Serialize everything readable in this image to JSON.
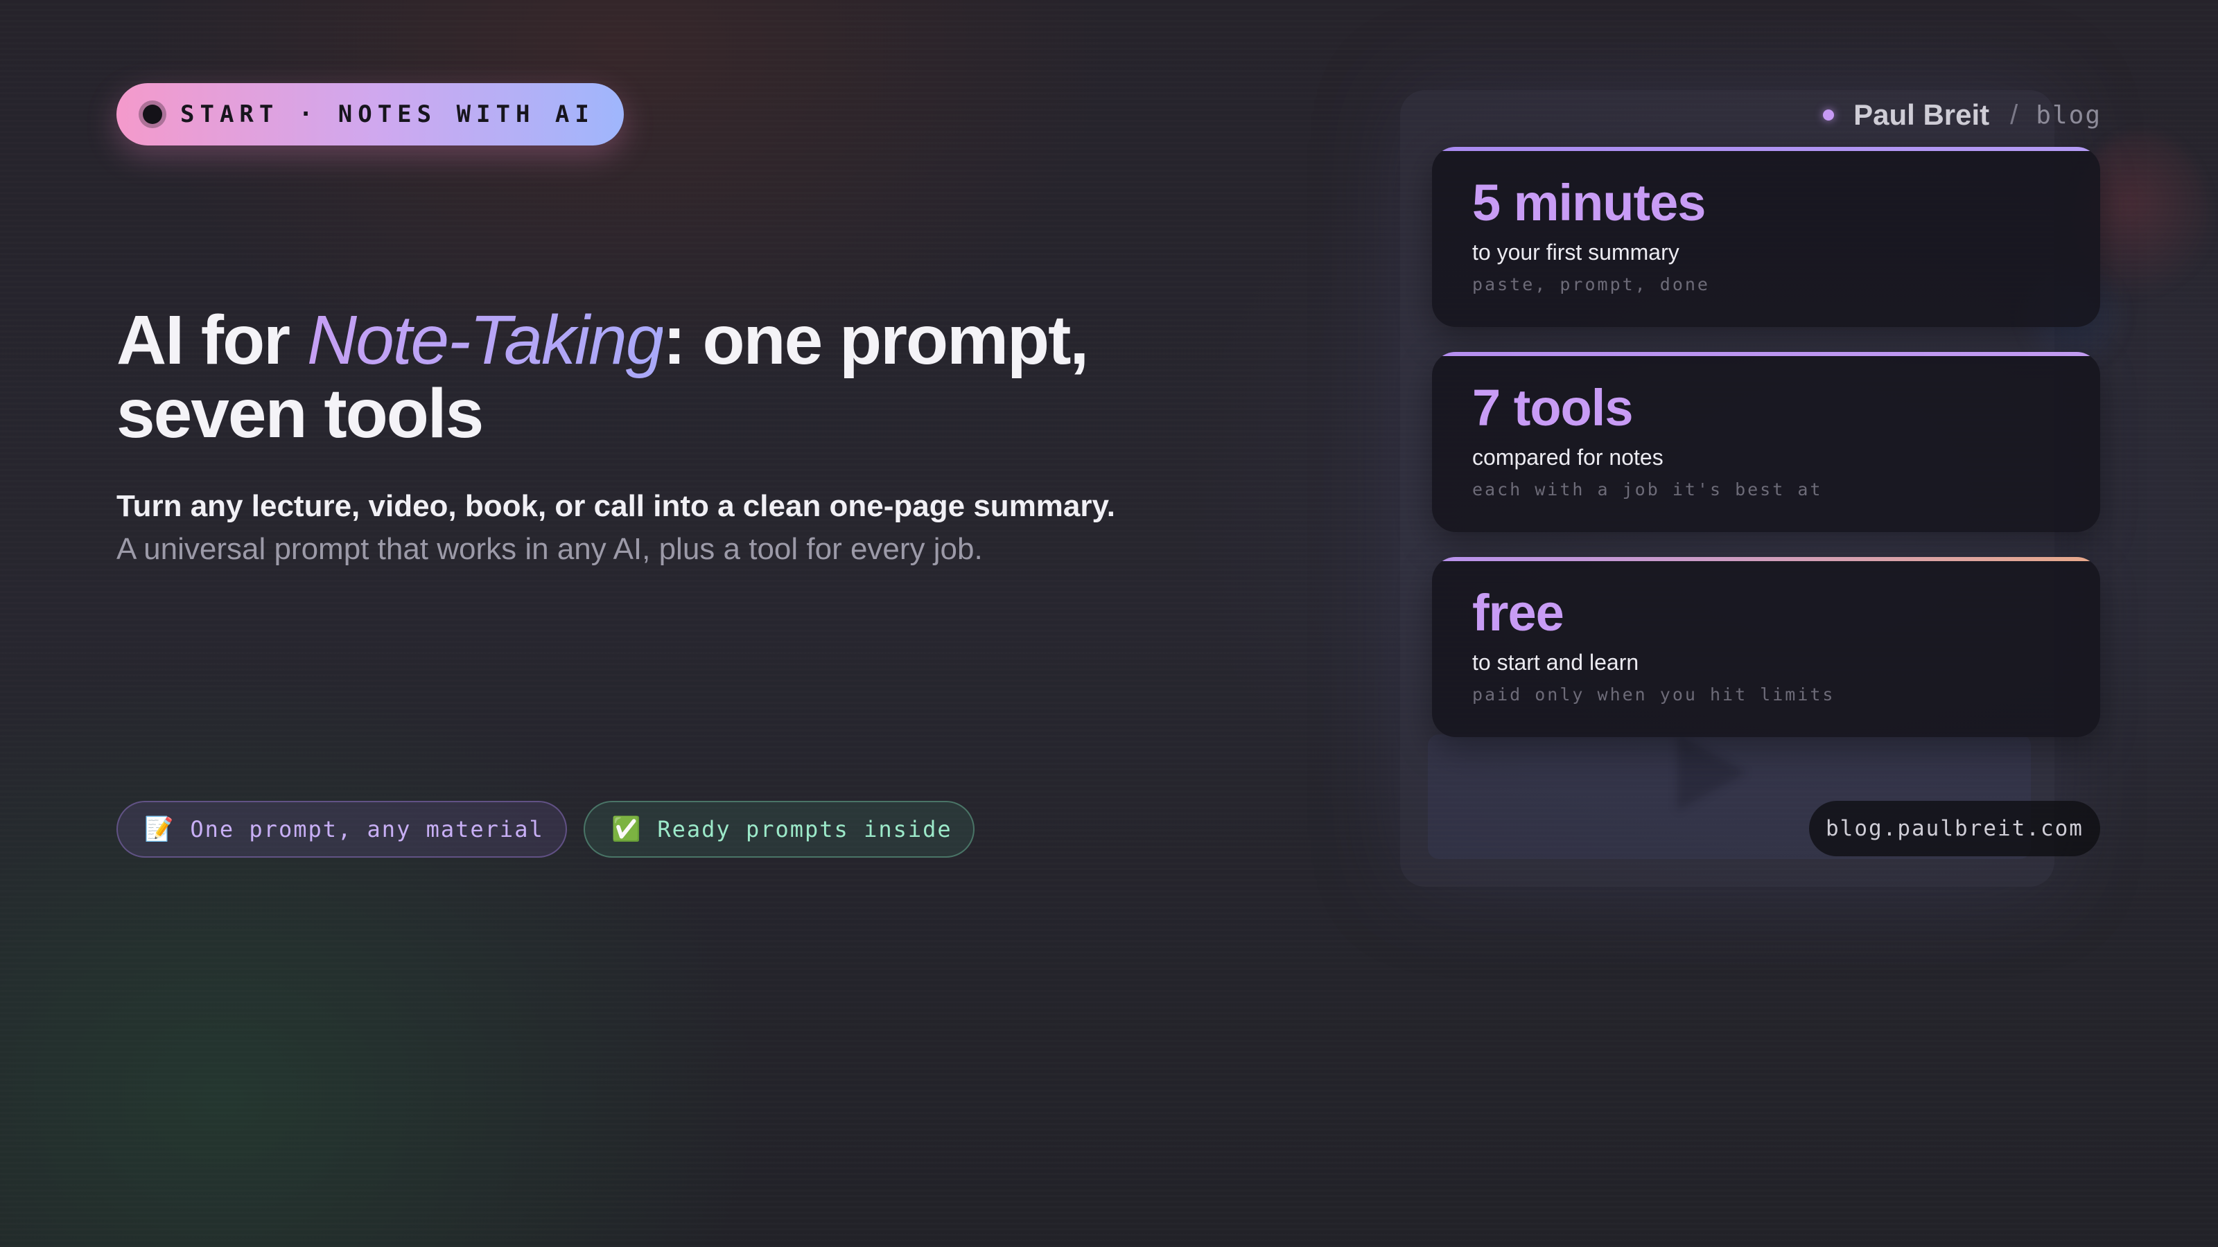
{
  "badge": {
    "text": "START · NOTES WITH AI"
  },
  "headline": {
    "prefix": "AI for ",
    "highlight": "Note-Taking",
    "suffix": ": one prompt, seven tools"
  },
  "subtitle": {
    "primary": "Turn any lecture, video, book, or call into a clean one-page summary.",
    "secondary": "A universal prompt that works in any AI, plus a tool for every job."
  },
  "tags": [
    {
      "emoji": "📝",
      "label": "One prompt, any material"
    },
    {
      "emoji": "✅",
      "label": "Ready prompts inside"
    }
  ],
  "author": {
    "name": "Paul Breit",
    "separator": "/",
    "section": "blog"
  },
  "stats": [
    {
      "value": "5 minutes",
      "label": "to your first summary",
      "note": "paste, prompt, done"
    },
    {
      "value": "7 tools",
      "label": "compared for notes",
      "note": "each with a job it's best at"
    },
    {
      "value": "free",
      "label": "to start and learn",
      "note": "paid only when you hit limits"
    }
  ],
  "url": "blog.paulbreit.com",
  "colors": {
    "accent_purple": "#c89cf5",
    "badge_pink": "#f49acb",
    "badge_blue": "#9fb6fc",
    "tag_green": "#9ce9c9",
    "card_bar_1": "#a98af0",
    "card_bar_2": "#b58ff0",
    "card_bar_3": "#e8a98a"
  }
}
